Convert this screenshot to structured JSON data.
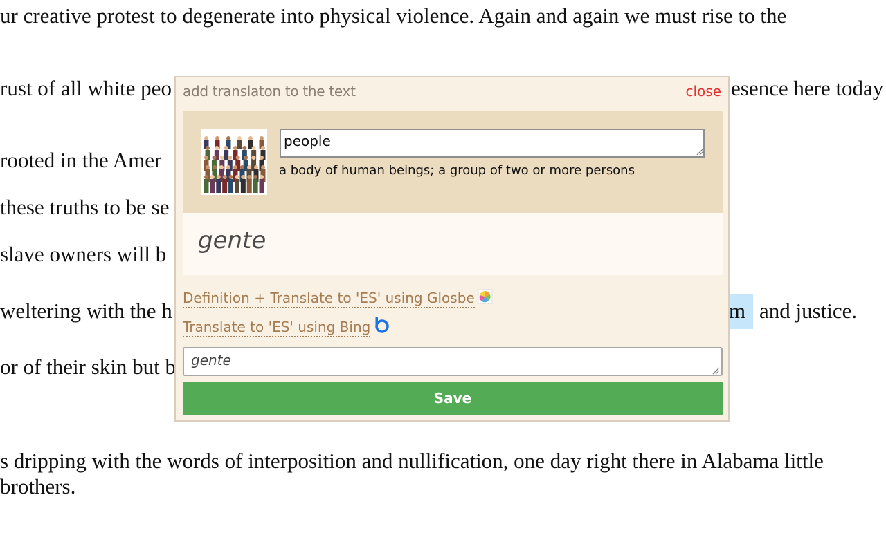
{
  "background_text": {
    "line1": "ur creative protest to degenerate into physical violence. Again and again we must rise to the",
    "line2_left": "rust of all white peo",
    "line2_right": "esence here today",
    "line3": "rooted in the Amer",
    "line4": "these truths to be se",
    "line5": "slave owners will b",
    "line6_left": "weltering with the h",
    "line6_highlight": "m",
    "line6_right": "and justice.",
    "line7": "or of their skin but b",
    "line8": "s dripping with the words of interposition and nullification, one day right there in Alabama little",
    "line9": "brothers.",
    "highlight_color": "#c6e6fb"
  },
  "popup": {
    "title": "add translaton to the text",
    "close_label": "close",
    "word": "people",
    "definition": "a body of human beings; a group of two or more persons",
    "translation": "gente",
    "links": {
      "glosbe": "Definition + Translate to 'ES' using Glosbe",
      "bing": "Translate to 'ES' using Bing"
    },
    "edit_value": "gente",
    "save_label": "Save",
    "colors": {
      "background": "#f9f1e4",
      "word_box": "#ecdcbf",
      "close": "#e43030",
      "link": "#a67c52",
      "save": "#54ab56"
    }
  }
}
